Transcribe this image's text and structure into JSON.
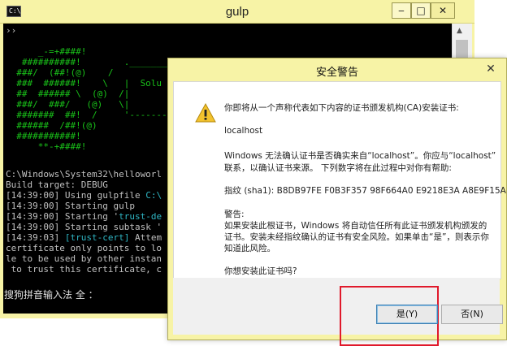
{
  "console": {
    "title": "gulp",
    "icon": "C:\\",
    "buttons": {
      "minimize": "‒",
      "maximize": "□",
      "close": "✕"
    },
    "prompt": "››",
    "ascii_art": [
      "      _-=+####!",
      "   ##########!        .________________",
      "  ###/  (##!(@)    /                   ",
      "  ###  ######!    \\   |  Solu",
      "  ##  ###### \\  (@)  /|",
      "  ###/  ###/   (@)   \\|",
      "  #######  ##!  /     '-----------------",
      "  ######  /##!(@)",
      "  ###########!",
      "      **-+####!"
    ],
    "log_lines": [
      {
        "text": "C:\\Windows\\System32\\helloworl",
        "cls": ""
      },
      {
        "text": "Build target: DEBUG",
        "cls": ""
      },
      {
        "time": "[14:39:00]",
        "msg": " Using gulpfile ",
        "hl": "C:\\",
        "cls": ""
      },
      {
        "time": "[14:39:00]",
        "msg": " Starting gulp",
        "hl": "",
        "cls": ""
      },
      {
        "time": "[14:39:00]",
        "msg": " Starting '",
        "hl": "trust-de",
        "cls": ""
      },
      {
        "time": "[14:39:00]",
        "msg": " Starting subtask '",
        "hl": "",
        "cls": ""
      },
      {
        "time": "[14:39:03]",
        "msg": " ",
        "hl": "[trust-cert]",
        "tail": " Attem",
        "cls": ""
      },
      {
        "text": "certificate only points to lo",
        "cls": ""
      },
      {
        "text": "le to be used by other instan",
        "cls": ""
      },
      {
        "text": " to trust this certificate, c",
        "cls": ""
      }
    ],
    "ime_status": "搜狗拼音输入法 全 ："
  },
  "dialog": {
    "title": "安全警告",
    "close": "✕",
    "line1": "你即将从一个声称代表如下内容的证书颁发机构(CA)安装证书:",
    "host": "localhost",
    "line2a": "Windows 无法确认证书是否确实来自“localhost”。你应与“localhost”",
    "line2b": "联系，以确认证书来源。 下列数字将在此过程中对你有帮助:",
    "thumbprint": "指纹 (sha1): B8DB97FE F0B3F357 98F664A0 E9218E3A A8E9F15A",
    "warning_title": "警告:",
    "warning_a": "如果安装此根证书，Windows 将自动信任所有此证书颁发机构颁发的",
    "warning_b": "证书。安装未经指纹确认的证书有安全风险。如果单击“是”，则表示你",
    "warning_c": "知道此风险。",
    "question": "你想安装此证书吗?",
    "yes_label": "是(Y)",
    "no_label": "否(N)"
  },
  "colors": {
    "titlebar": "#f7f3a6",
    "highlight_box": "#e0192b",
    "ascii_green": "#19c119"
  }
}
